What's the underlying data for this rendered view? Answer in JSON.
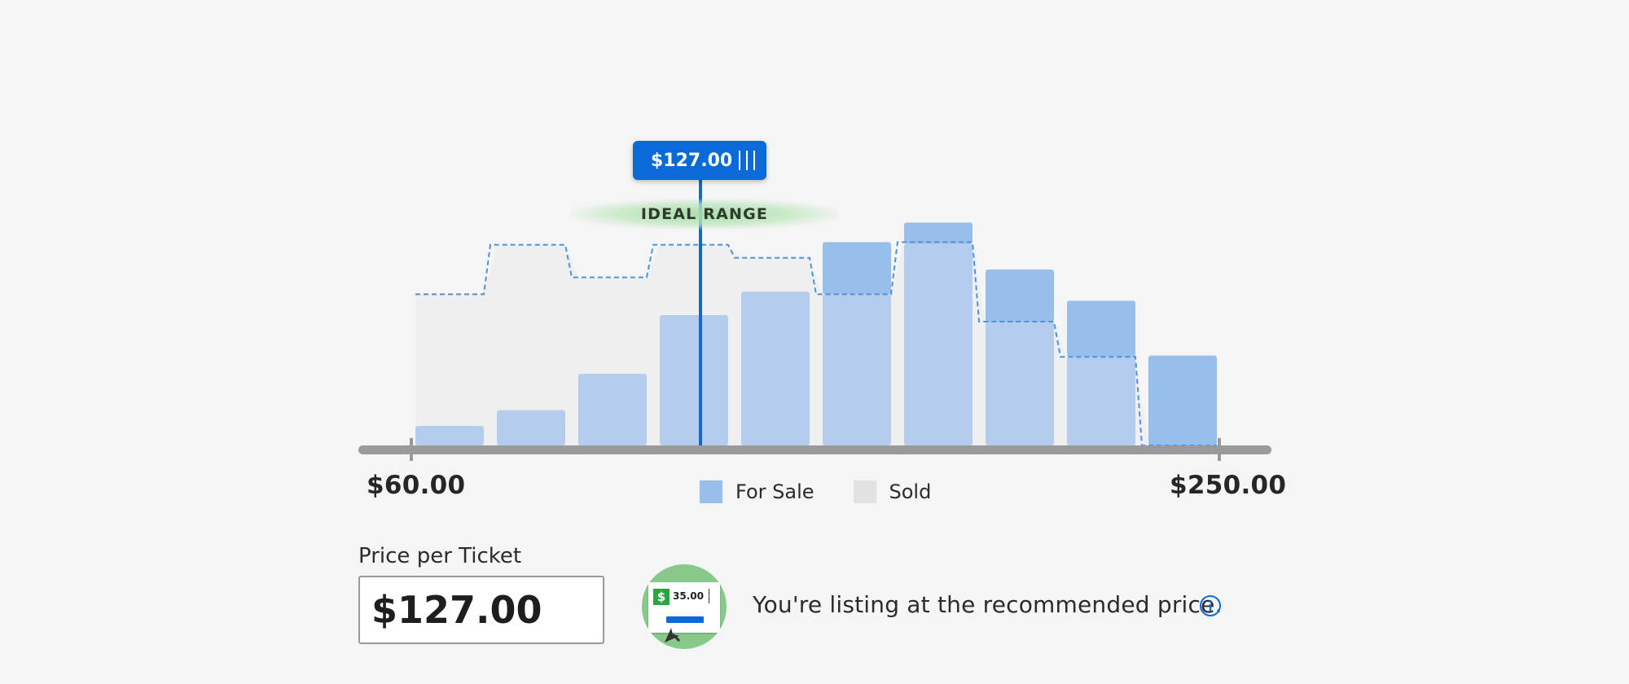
{
  "slider": {
    "min_label": "$60.00",
    "max_label": "$250.00",
    "handle_label": "$127.00",
    "ideal_range_label": "IDEAL RANGE"
  },
  "legend": {
    "for_sale": "For Sale",
    "sold": "Sold"
  },
  "price_field": {
    "label": "Price per Ticket",
    "value": "$127.00"
  },
  "recommendation": {
    "text": "You're listing at the recommended price.",
    "illustration_amount": "35.00",
    "illustration_symbol": "$"
  },
  "colors": {
    "accent": "#0a6bd8",
    "for_sale": "#97bfec",
    "sold": "#e2e2e2",
    "recommended": "#86c98a"
  },
  "icons": [
    "grip-icon",
    "info-icon",
    "cursor-icon",
    "dollar-icon"
  ],
  "chart_data": {
    "type": "bar",
    "x_range": [
      60,
      250
    ],
    "selected_price": 127,
    "bins": 10,
    "bars": [
      {
        "for_sale": 1.5,
        "sold": 0
      },
      {
        "for_sale": 2.7,
        "sold": 0
      },
      {
        "for_sale": 5.5,
        "sold": 0
      },
      {
        "for_sale": 10,
        "sold": 0
      },
      {
        "for_sale": 11.8,
        "sold": 0
      },
      {
        "for_sale": 11.6,
        "sold": 4.0
      },
      {
        "for_sale": 15.5,
        "sold": 1.6
      },
      {
        "for_sale": 9.5,
        "sold": 4.0
      },
      {
        "for_sale": 6.8,
        "sold": 4.3
      },
      {
        "for_sale": 0,
        "sold": 6.9
      }
    ],
    "sold_outline": [
      11.6,
      15.4,
      12.9,
      15.4,
      14.4,
      11.6,
      15.6,
      9.5,
      6.8,
      0
    ]
  }
}
